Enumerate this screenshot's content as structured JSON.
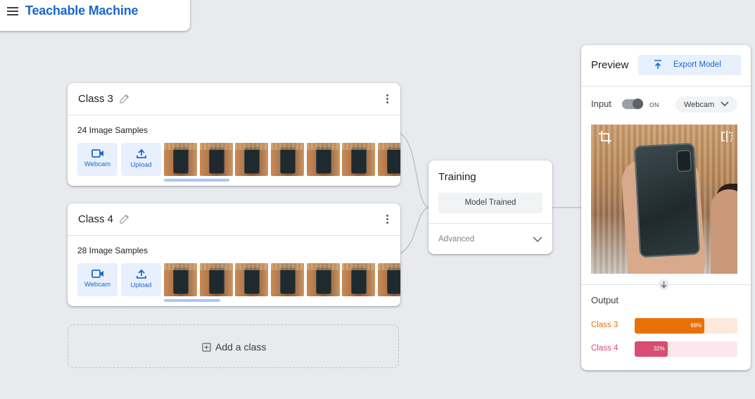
{
  "app": {
    "title": "Teachable Machine"
  },
  "classes": [
    {
      "title": "Class 3",
      "samples_label": "24 Image Samples",
      "webcam_label": "Webcam",
      "upload_label": "Upload"
    },
    {
      "title": "Class 4",
      "samples_label": "28 Image Samples",
      "webcam_label": "Webcam",
      "upload_label": "Upload"
    }
  ],
  "add_class_label": "Add a class",
  "training": {
    "title": "Training",
    "button_label": "Model Trained",
    "advanced_label": "Advanced"
  },
  "preview": {
    "title": "Preview",
    "export_label": "Export Model",
    "input_label": "Input",
    "toggle_label": "ON",
    "input_source": "Webcam",
    "output_label": "Output",
    "outputs": [
      {
        "label": "Class 3",
        "percent_text": "68%",
        "fraction": 0.68,
        "color": "#e8710a",
        "track": "#fde9dc"
      },
      {
        "label": "Class 4",
        "percent_text": "32%",
        "fraction": 0.32,
        "color": "#d94d70",
        "track": "#fde7ec"
      }
    ]
  },
  "colors": {
    "accent": "#1967d2",
    "background": "#e8eaed"
  },
  "icons": [
    "menu-icon",
    "pencil-icon",
    "more-vert-icon",
    "videocam-icon",
    "upload-icon",
    "add-box-icon",
    "chevron-down-icon",
    "export-upload-icon",
    "crop-icon",
    "flip-icon",
    "arrow-down-icon"
  ]
}
